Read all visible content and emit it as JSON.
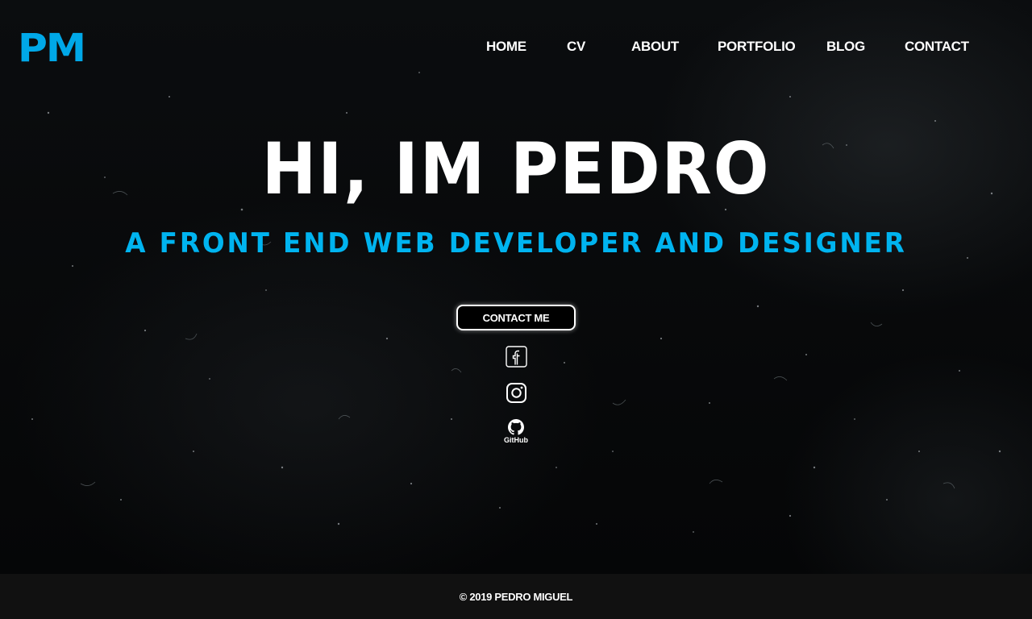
{
  "header": {
    "logo": "PM",
    "nav": [
      {
        "label": "HOME"
      },
      {
        "label": "CV"
      },
      {
        "label": "ABOUT"
      },
      {
        "label": "PORTFOLIO"
      },
      {
        "label": "BLOG"
      },
      {
        "label": "CONTACT"
      }
    ]
  },
  "hero": {
    "headline": "HI, IM PEDRO",
    "subheadline": "A FRONT END WEB DEVELOPER AND DESIGNER",
    "cta_label": "CONTACT ME"
  },
  "social": {
    "facebook_icon": "facebook-icon",
    "instagram_icon": "instagram-icon",
    "github_icon": "github-icon",
    "github_label": "GitHub"
  },
  "footer": {
    "copyright": "© 2019 PEDRO MIGUEL"
  },
  "colors": {
    "accent": "#00b4f0",
    "background": "#050708",
    "footer_bg": "#111111",
    "text": "#ffffff"
  }
}
